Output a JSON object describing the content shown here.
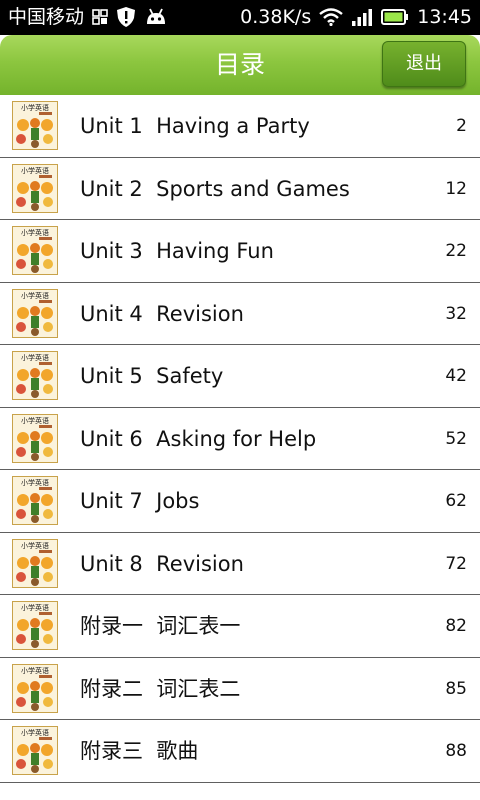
{
  "status_bar": {
    "carrier": "中国移动",
    "speed": "0.38K/s",
    "time": "13:45"
  },
  "header": {
    "title": "目录",
    "exit_label": "退出"
  },
  "thumbnail": {
    "book_title": "小学英语"
  },
  "items": [
    {
      "label": "Unit 1  Having a Party",
      "page": "2"
    },
    {
      "label": "Unit 2  Sports and Games",
      "page": "12"
    },
    {
      "label": "Unit 3  Having Fun",
      "page": "22"
    },
    {
      "label": "Unit 4  Revision",
      "page": "32"
    },
    {
      "label": "Unit 5  Safety",
      "page": "42"
    },
    {
      "label": "Unit 6  Asking for Help",
      "page": "52"
    },
    {
      "label": "Unit 7  Jobs",
      "page": "62"
    },
    {
      "label": "Unit 8  Revision",
      "page": "72"
    },
    {
      "label": "附录一  词汇表一",
      "page": "82"
    },
    {
      "label": "附录二  词汇表二",
      "page": "85"
    },
    {
      "label": "附录三  歌曲",
      "page": "88"
    }
  ],
  "colors": {
    "header_green": "#8cc63f",
    "exit_button": "#5f9d22",
    "battery_green": "#9be64a"
  }
}
